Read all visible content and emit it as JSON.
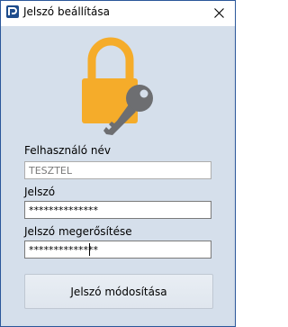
{
  "window": {
    "title": "Jelszó beállítása",
    "close_glyph": "✕"
  },
  "icons": {
    "app": "app-logo-icon",
    "close": "close-icon",
    "graphic": "lock-key-icon"
  },
  "colors": {
    "lock_body": "#f5ac2a",
    "key": "#6d6e71",
    "window_border": "#2b579a",
    "client_bg": "#d5dfeb"
  },
  "form": {
    "username_label": "Felhasználó név",
    "username_value": "TESZTEL",
    "password_label": "Jelszó",
    "password_value": "**************",
    "confirm_label": "Jelszó megerősítése",
    "confirm_value": "**************",
    "submit_label": "Jelszó módosítása"
  }
}
